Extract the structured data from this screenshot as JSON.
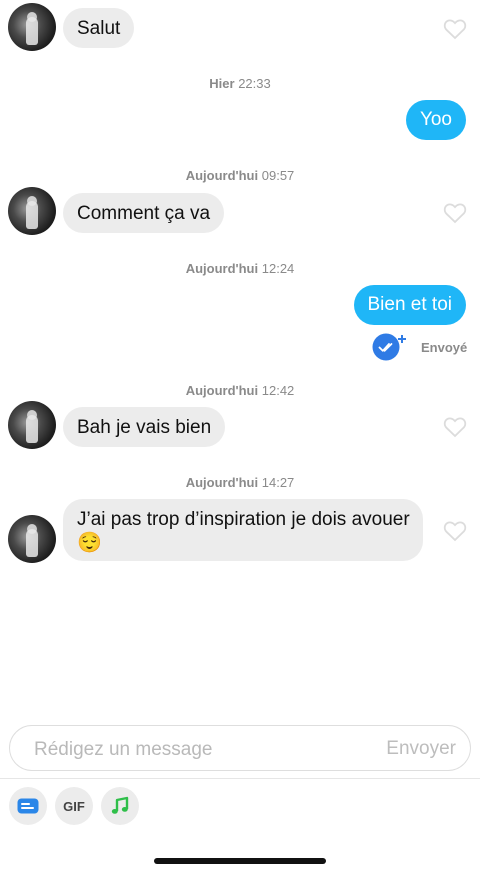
{
  "messages": {
    "m1": {
      "text": "Salut"
    },
    "ts1": {
      "day": "Hier",
      "time": "22:33"
    },
    "m2": {
      "text": "Yoo"
    },
    "ts2": {
      "day": "Aujourd'hui",
      "time": "09:57"
    },
    "m3": {
      "text": "Comment ça va"
    },
    "ts3": {
      "day": "Aujourd'hui",
      "time": "12:24"
    },
    "m4": {
      "text": "Bien et toi",
      "status": "Envoyé"
    },
    "ts4": {
      "day": "Aujourd'hui",
      "time": "12:42"
    },
    "m5": {
      "text": "Bah je vais bien"
    },
    "ts5": {
      "day": "Aujourd'hui",
      "time": "14:27"
    },
    "m6": {
      "line1": "J’ai pas trop d’inspiration je dois avouer",
      "emoji": "😌"
    }
  },
  "composer": {
    "placeholder": "Rédigez un message",
    "send_label": "Envoyer"
  },
  "toolbar": {
    "gif_label": "GIF"
  },
  "colors": {
    "outgoing_bubble": "#1fb6f7",
    "incoming_bubble": "#ececec",
    "read_receipt": "#2f7be5",
    "music_icon": "#2fbf4a"
  }
}
